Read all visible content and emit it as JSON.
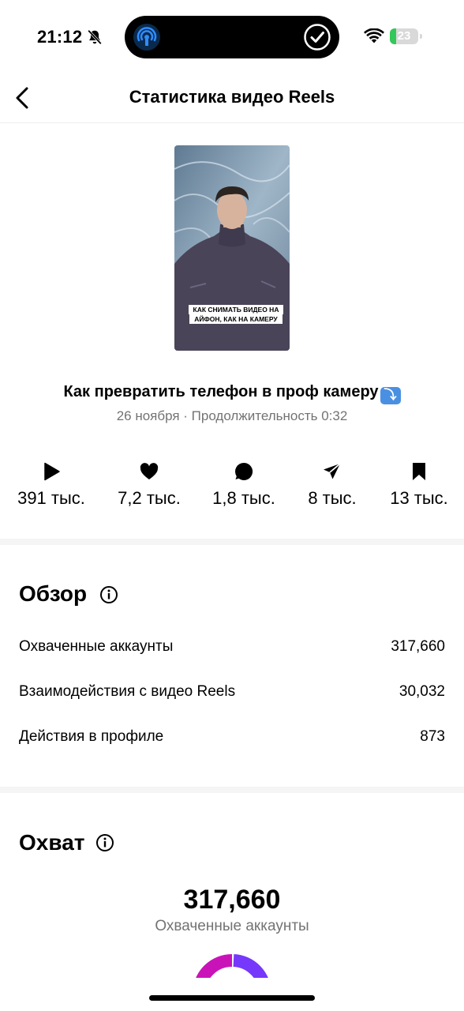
{
  "status_bar": {
    "time": "21:12",
    "battery_level": "23",
    "battery_fraction": 0.23,
    "battery_color": "#34c759"
  },
  "nav": {
    "title": "Статистика видео Reels",
    "back_icon": "chevron-left-icon"
  },
  "reel": {
    "thumbnail_caption_line1": "КАК СНИМАТЬ ВИДЕО НА",
    "thumbnail_caption_line2": "АЙФОН, КАК НА КАМЕРУ",
    "title": "Как превратить телефон в проф камеру",
    "title_emoji": "⤵",
    "meta": "26 ноября · Продолжительность 0:32"
  },
  "stats": [
    {
      "icon": "play-icon",
      "value": "391 тыс."
    },
    {
      "icon": "heart-icon",
      "value": "7,2 тыс."
    },
    {
      "icon": "comment-icon",
      "value": "1,8 тыс."
    },
    {
      "icon": "share-icon",
      "value": "8 тыс."
    },
    {
      "icon": "bookmark-icon",
      "value": "13 тыс."
    }
  ],
  "overview": {
    "title": "Обзор",
    "rows": [
      {
        "label": "Охваченные аккаунты",
        "value": "317,660"
      },
      {
        "label": "Взаимодействия с видео Reels",
        "value": "30,032"
      },
      {
        "label": "Действия в профиле",
        "value": "873"
      }
    ]
  },
  "reach": {
    "title": "Охват",
    "value": "317,660",
    "label": "Охваченные аккаунты",
    "donut_colors": [
      "#c913b9",
      "#7638fa"
    ]
  }
}
